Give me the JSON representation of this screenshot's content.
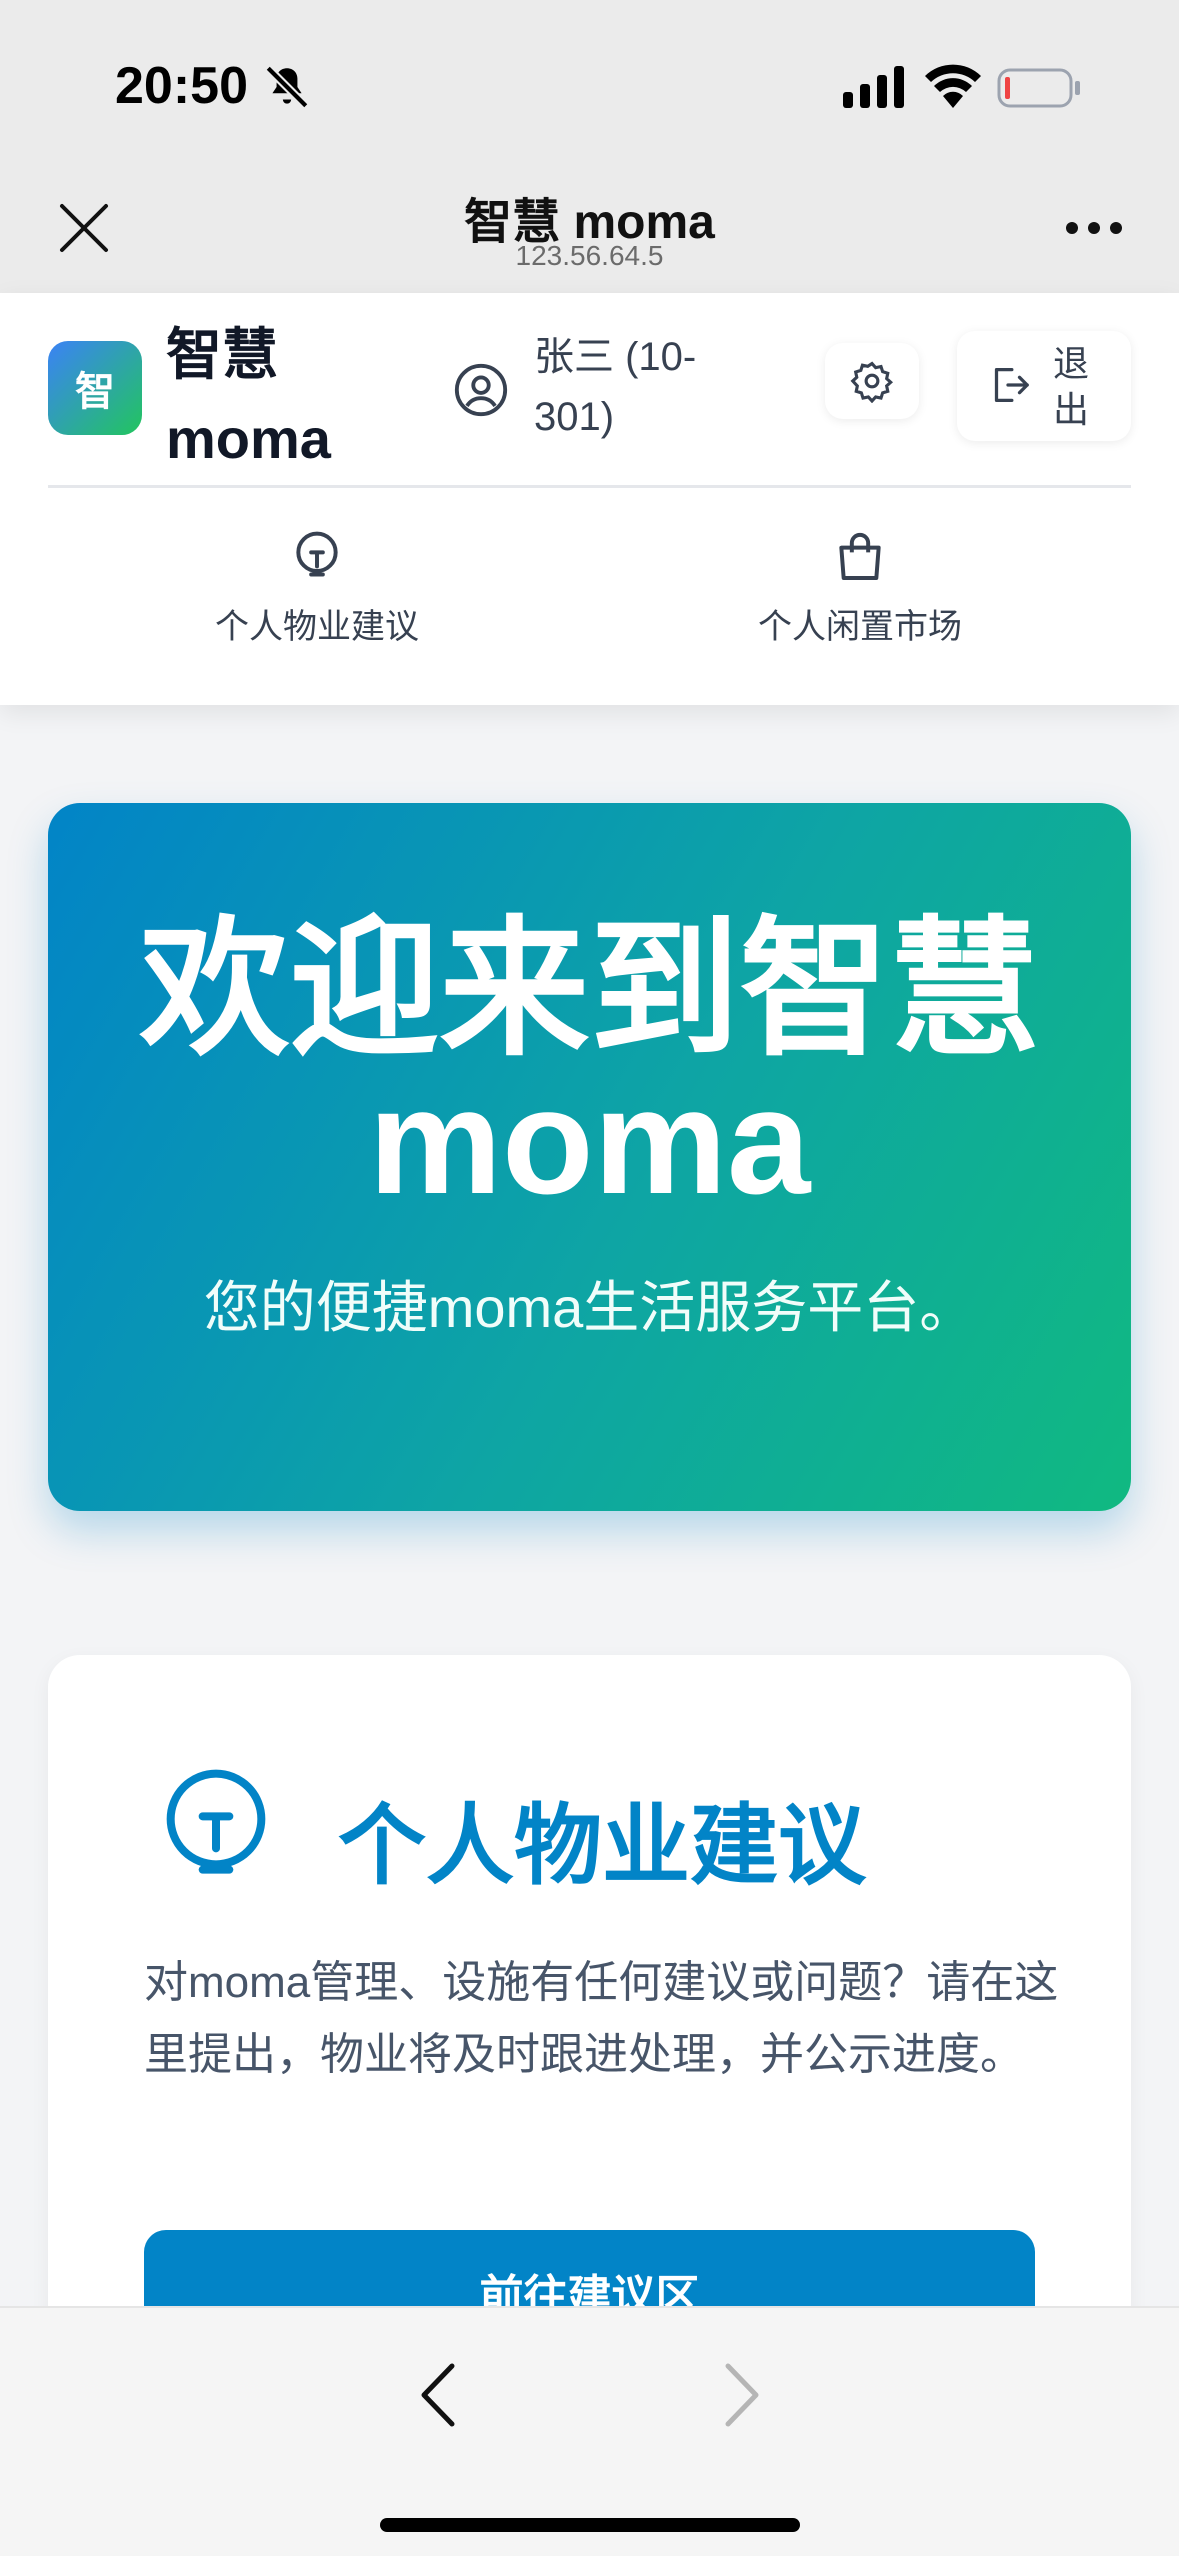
{
  "status_bar": {
    "time": "20:50",
    "icons": [
      "bell-slash-icon",
      "signal-icon",
      "wifi-icon",
      "battery-icon"
    ],
    "battery_color": "#ef4444"
  },
  "browser": {
    "title": "智慧 moma",
    "url": "123.56.64.5",
    "icons": [
      "close-icon",
      "more-icon",
      "back-icon",
      "forward-icon"
    ]
  },
  "header": {
    "logo_char": "智",
    "brand": "智慧 moma",
    "user": "张三 (10-301)",
    "logout_label": "退出",
    "nav": [
      {
        "label": "个人物业建议",
        "icon": "lightbulb-icon"
      },
      {
        "label": "个人闲置市场",
        "icon": "shopping-bag-icon"
      }
    ]
  },
  "hero": {
    "title": "欢迎来到智慧 moma",
    "subtitle": "您的便捷moma生活服务平台。"
  },
  "card": {
    "title": "个人物业建议",
    "description": "对moma管理、设施有任何建议或问题？请在这里提出，物业将及时跟进处理，并公示进度。",
    "button": "前往建议区"
  },
  "colors": {
    "primary": "#0284c7",
    "accent_green": "#10b981"
  }
}
